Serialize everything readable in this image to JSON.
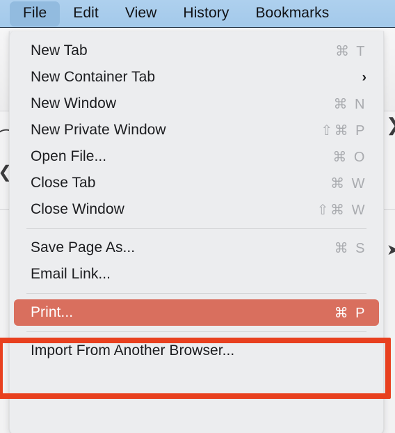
{
  "menubar": {
    "items": [
      {
        "label": "File",
        "active": true
      },
      {
        "label": "Edit",
        "active": false
      },
      {
        "label": "View",
        "active": false
      },
      {
        "label": "History",
        "active": false
      },
      {
        "label": "Bookmarks",
        "active": false
      }
    ]
  },
  "file_menu": {
    "rows": [
      {
        "type": "item",
        "label": "New Tab",
        "shortcut": "⌘ T"
      },
      {
        "type": "item",
        "label": "New Container Tab",
        "submenu": "›"
      },
      {
        "type": "item",
        "label": "New Window",
        "shortcut": "⌘ N"
      },
      {
        "type": "item",
        "label": "New Private Window",
        "shortcut": "⇧⌘ P"
      },
      {
        "type": "item",
        "label": "Open File...",
        "shortcut": "⌘ O"
      },
      {
        "type": "item",
        "label": "Close Tab",
        "shortcut": "⌘ W"
      },
      {
        "type": "item",
        "label": "Close Window",
        "shortcut": "⇧⌘ W"
      },
      {
        "type": "separator"
      },
      {
        "type": "item",
        "label": "Save Page As...",
        "shortcut": "⌘ S"
      },
      {
        "type": "item",
        "label": "Email Link...",
        "shortcut": ""
      },
      {
        "type": "separator"
      },
      {
        "type": "item",
        "label": "Print...",
        "shortcut": "⌘ P",
        "highlighted": true
      },
      {
        "type": "separator"
      },
      {
        "type": "item",
        "label": "Import From Another Browser...",
        "shortcut": ""
      }
    ]
  },
  "annotation": {
    "target_label": "Print...",
    "color": "#e8401f"
  },
  "colors": {
    "menubar_bg": "#a3c9ea",
    "menubar_active": "#92bbdf",
    "panel_bg": "#ecedef",
    "highlight_row": "#d96f5e",
    "shortcut_text": "#a9abaf",
    "label_text": "#1b1c1f",
    "separator": "#d4d5d7"
  },
  "background": {
    "glyphs": [
      "⌢",
      "❮",
      "❯",
      "➤"
    ]
  }
}
